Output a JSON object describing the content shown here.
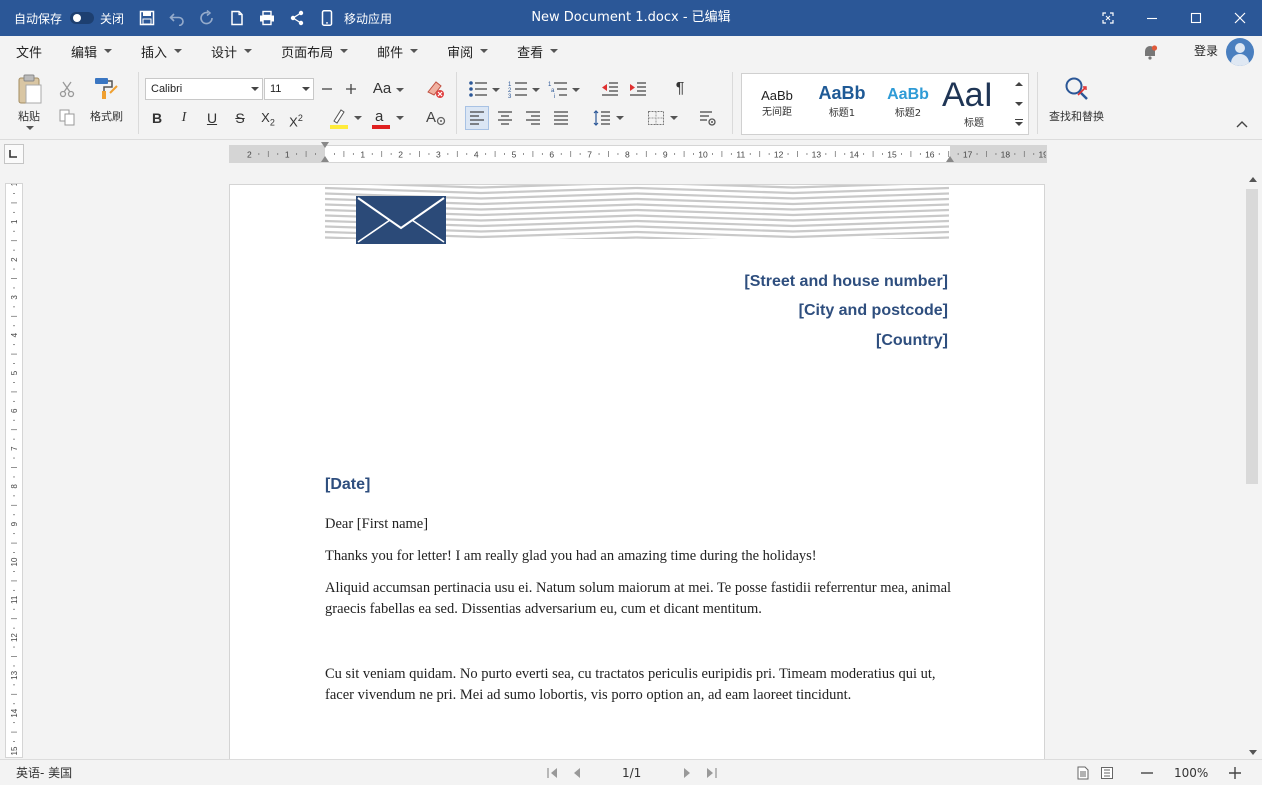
{
  "titlebar": {
    "autosave_label": "自动保存",
    "autosave_state": "关闭",
    "mobile_label": "移动应用",
    "document_title": "New Document 1.docx - 已编辑"
  },
  "menu": {
    "items": [
      "文件",
      "编辑",
      "插入",
      "设计",
      "页面布局",
      "邮件",
      "审阅",
      "查看"
    ],
    "login": "登录"
  },
  "ribbon": {
    "paste_label": "粘贴",
    "format_painter_label": "格式刷",
    "font_name": "Calibri",
    "font_size": "11",
    "case_label": "Aa",
    "styles": [
      {
        "sample": "AaBb",
        "name": "无间距"
      },
      {
        "sample": "AaBb",
        "name": "标题1"
      },
      {
        "sample": "AaBb",
        "name": "标题2"
      },
      {
        "sample": "AaI",
        "name": "标题"
      }
    ],
    "find_replace_label": "查找和替换",
    "accent_color": "#2b5797"
  },
  "ruler": {
    "numbers": [
      "2",
      "1",
      "1",
      "2",
      "3",
      "4",
      "5",
      "6",
      "7",
      "8",
      "9",
      "10",
      "11",
      "12",
      "13",
      "14",
      "15",
      "16",
      "17",
      "18",
      "19"
    ],
    "vnumbers": [
      "1",
      "1",
      "2",
      "3",
      "4",
      "5",
      "6",
      "7",
      "8",
      "9",
      "10",
      "11",
      "12",
      "13",
      "14",
      "15"
    ]
  },
  "document": {
    "address": [
      "[Street and house number]",
      "[City and postcode]",
      "[Country]"
    ],
    "date": "[Date]",
    "salutation": "Dear [First name]",
    "paragraphs": [
      "Thanks you for letter! I am really glad you had an amazing time during the holidays!",
      "Aliquid accumsan pertinacia usu ei. Natum solum maiorum at mei. Te posse fastidii referrentur mea, animal graecis fabellas ea sed. Dissentias adversarium eu, cum et dicant mentitum.",
      "Cu sit veniam quidam. No purto everti sea, cu tractatos periculis euripidis pri. Timeam moderatius qui ut, facer vivendum ne pri. Mei ad sumo lobortis, vis porro option an, ad eam laoreet tincidunt."
    ],
    "heading_color": "#2e4e7e"
  },
  "status": {
    "language": "英语- 美国",
    "page": "1/1",
    "zoom": "100%"
  }
}
